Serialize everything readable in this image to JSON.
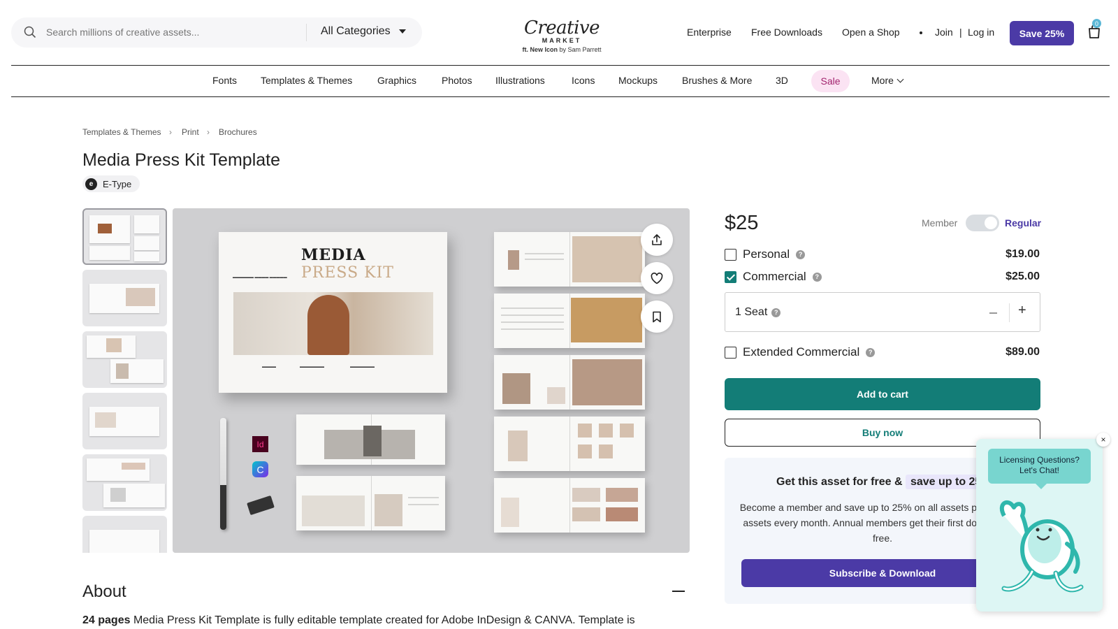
{
  "header": {
    "search_placeholder": "Search millions of creative assets...",
    "category_select": "All Categories",
    "logo_script": "Creative",
    "logo_market": "MARKET",
    "logo_feat_prefix": "ft. New Icon",
    "logo_feat_by": "by Sam Parrett",
    "links": [
      "Enterprise",
      "Free Downloads",
      "Open a Shop"
    ],
    "join": "Join",
    "separator": "|",
    "login": "Log in",
    "save_button": "Save 25%",
    "cart_count": "0"
  },
  "category_nav": [
    "Fonts",
    "Templates & Themes",
    "Graphics",
    "Photos",
    "Illustrations",
    "Icons",
    "Mockups",
    "Brushes & More",
    "3D"
  ],
  "sale_label": "Sale",
  "more_label": "More",
  "breadcrumb": [
    "Templates & Themes",
    "Print",
    "Brochures"
  ],
  "product": {
    "title": "Media Press Kit Template",
    "shop_name": "E-Type",
    "shop_initial": "e"
  },
  "preview": {
    "cover_title_1": "MEDIA",
    "cover_title_2": "PRESS KIT",
    "app_id": "Id",
    "app_c": "C"
  },
  "about": {
    "heading": "About",
    "pages": "24 pages",
    "text": "Media Press Kit Template is fully editable template created for Adobe InDesign & CANVA. Template is"
  },
  "pricing": {
    "price": "$25",
    "member_label": "Member",
    "regular_label": "Regular",
    "member_pricing_on": false,
    "licenses": [
      {
        "name": "Personal",
        "price": "$19.00",
        "checked": false
      },
      {
        "name": "Commercial",
        "price": "$25.00",
        "checked": true
      },
      {
        "name": "Extended Commercial",
        "price": "$89.00",
        "checked": false
      }
    ],
    "seat_label": "1 Seat",
    "add_to_cart": "Add to cart",
    "buy_now": "Buy now"
  },
  "promo": {
    "heading_prefix": "Get this asset for free &",
    "heading_highlight": "save up to 25%",
    "body": "Become a member and save up to 25% on all assets plus get free assets every month. Annual members get their first download for free.",
    "button": "Subscribe & Download"
  },
  "chat": {
    "bubble_line1": "Licensing Questions?",
    "bubble_line2": "Let's Chat!",
    "close": "×"
  },
  "colors": {
    "brand_purple": "#4b3aa6",
    "teal": "#137d77",
    "sale_pink": "#a2236e"
  }
}
